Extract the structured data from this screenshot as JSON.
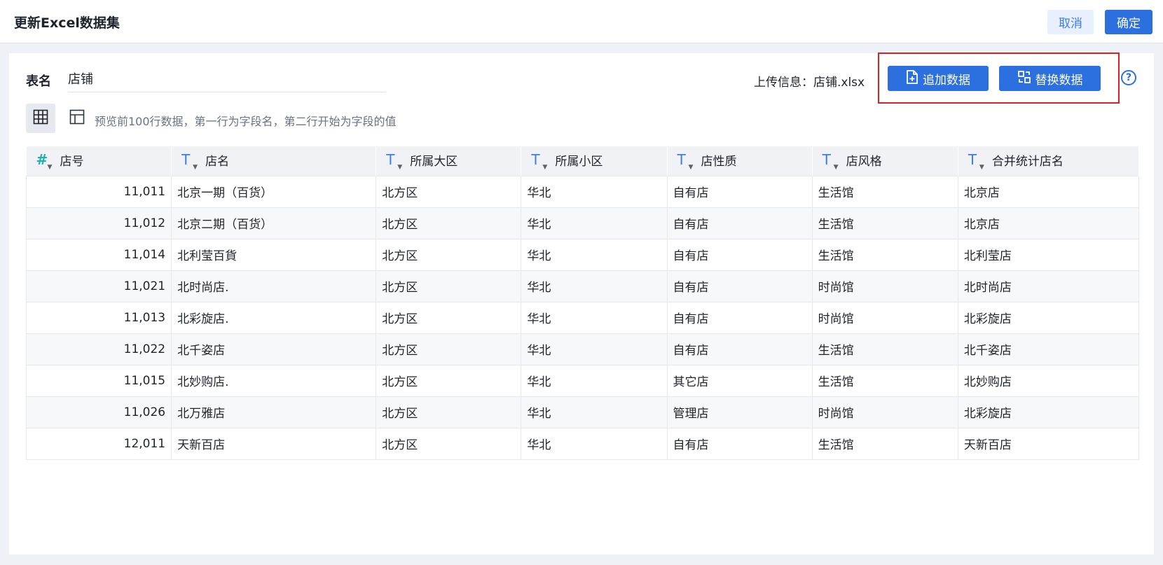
{
  "header": {
    "title": "更新Excel数据集",
    "cancel_label": "取消",
    "confirm_label": "确定"
  },
  "form": {
    "name_label": "表名",
    "name_value": "店铺",
    "upload_info": "上传信息：店铺.xlsx",
    "append_label": "追加数据",
    "replace_label": "替换数据"
  },
  "preview": {
    "hint": "预览前100行数据，第一行为字段名，第二行开始为字段的值"
  },
  "table": {
    "columns": [
      {
        "label": "店号",
        "type_icon": "#"
      },
      {
        "label": "店名",
        "type_icon": "T"
      },
      {
        "label": "所属大区",
        "type_icon": "T"
      },
      {
        "label": "所属小区",
        "type_icon": "T"
      },
      {
        "label": "店性质",
        "type_icon": "T"
      },
      {
        "label": "店风格",
        "type_icon": "T"
      },
      {
        "label": "合并统计店名",
        "type_icon": "T"
      }
    ],
    "rows": [
      [
        "11,011",
        "北京一期（百货）",
        "北方区",
        "华北",
        "自有店",
        "生活馆",
        "北京店"
      ],
      [
        "11,012",
        "北京二期（百货）",
        "北方区",
        "华北",
        "自有店",
        "生活馆",
        "北京店"
      ],
      [
        "11,014",
        "北利莹百貨",
        "北方区",
        "华北",
        "自有店",
        "生活馆",
        "北利莹店"
      ],
      [
        "11,021",
        "北时尚店.",
        "北方区",
        "华北",
        "自有店",
        "时尚馆",
        "北时尚店"
      ],
      [
        "11,013",
        "北彩旋店.",
        "北方区",
        "华北",
        "自有店",
        "时尚馆",
        "北彩旋店"
      ],
      [
        "11,022",
        "北千姿店",
        "北方区",
        "华北",
        "自有店",
        "生活馆",
        "北千姿店"
      ],
      [
        "11,015",
        "北妙购店.",
        "北方区",
        "华北",
        "其它店",
        "生活馆",
        "北妙购店"
      ],
      [
        "11,026",
        "北万雅店",
        "北方区",
        "华北",
        "管理店",
        "时尚馆",
        "北彩旋店"
      ],
      [
        "12,011",
        "天新百店",
        "北方区",
        "华北",
        "自有店",
        "生活馆",
        "天新百店"
      ]
    ]
  },
  "colors": {
    "primary": "#2c6fdf",
    "highlight": "#e02020",
    "number_type": "#20b2aa"
  },
  "icons": {
    "append": "file-plus-icon",
    "replace": "swap-icon",
    "help": "question-circle-icon",
    "grid_view": "grid-view-icon",
    "table_view": "table-layout-icon"
  }
}
